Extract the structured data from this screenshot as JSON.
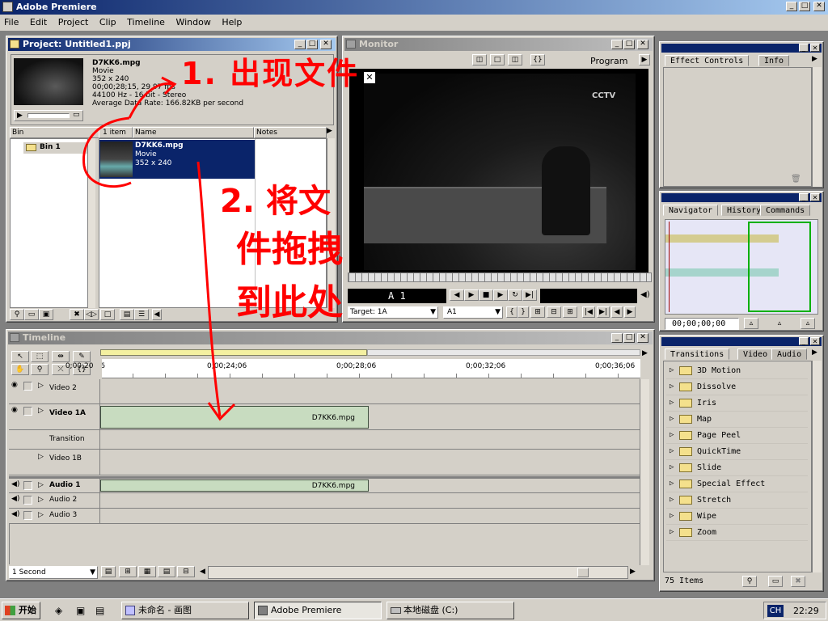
{
  "app": {
    "title": "Adobe Premiere"
  },
  "menu": [
    "File",
    "Edit",
    "Project",
    "Clip",
    "Timeline",
    "Window",
    "Help"
  ],
  "project": {
    "title": "Project: Untitled1.ppj",
    "preview": {
      "name": "D7KK6.mpg",
      "type": "Movie",
      "size": "352 x 240",
      "duration": "00;00;28;15, 29.97 fps",
      "audio": "44100 Hz - 16 bit - Stereo",
      "rate": "Average Data Rate: 166.82KB per second"
    },
    "bin_header": "Bin",
    "count_header": "1 item",
    "name_header": "Name",
    "notes_header": "Notes",
    "bin_label": "Bin 1",
    "item": {
      "name": "D7KK6.mpg",
      "type": "Movie",
      "size": "352 x 240"
    }
  },
  "monitor": {
    "title": "Monitor",
    "program_label": "Program",
    "timecode": "A 1",
    "target_label": "Target: 1A",
    "audio_target": "A1"
  },
  "timeline": {
    "title": "Timeline",
    "ruler": [
      "0;00;20;06",
      "0;00;24;06",
      "0;00;28;06",
      "0;00;32;06",
      "0;00;36;06"
    ],
    "tracks": {
      "video2": "Video 2",
      "video1a": "Video 1A",
      "transition": "Transition",
      "video1b": "Video 1B",
      "audio1": "Audio 1",
      "audio2": "Audio 2",
      "audio3": "Audio 3"
    },
    "clip_video": "D7KK6.mpg",
    "clip_audio": "D7KK6.mpg",
    "zoom": "1 Second"
  },
  "effects": {
    "tab1": "Effect Controls",
    "tab2": "Info"
  },
  "navigator": {
    "tab1": "Navigator",
    "tab2": "History",
    "tab3": "Commands",
    "timecode": "00;00;00;00"
  },
  "transitions": {
    "tab1": "Transitions",
    "tab2": "Video",
    "tab3": "Audio",
    "items": [
      "3D Motion",
      "Dissolve",
      "Iris",
      "Map",
      "Page Peel",
      "QuickTime",
      "Slide",
      "Special Effect",
      "Stretch",
      "Wipe",
      "Zoom"
    ],
    "count": "75 Items"
  },
  "annotations": {
    "step1": "1. 出现文件",
    "step2a": "2. 将文",
    "step2b": "件拖拽",
    "step2c": "到此处"
  },
  "taskbar": {
    "start": "开始",
    "items": [
      "未命名 - 画图",
      "Adobe Premiere",
      "本地磁盘 (C:)"
    ],
    "ime": "CH",
    "clock": "22:29"
  },
  "colors": {
    "title_active": "#0a246a",
    "selection": "#0a246a",
    "annotation": "#ff0000"
  }
}
